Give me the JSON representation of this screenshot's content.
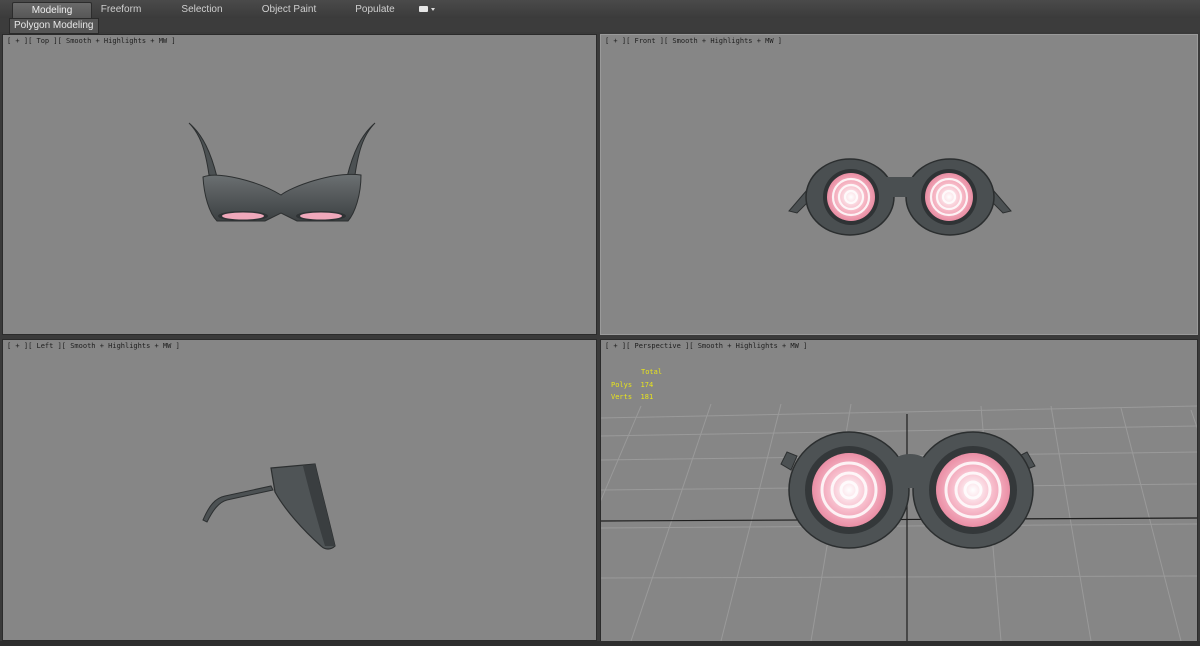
{
  "ribbon": {
    "tabs": [
      {
        "label": "Modeling",
        "active": true
      },
      {
        "label": "Freeform",
        "active": false
      },
      {
        "label": "Selection",
        "active": false
      },
      {
        "label": "Object Paint",
        "active": false
      },
      {
        "label": "Populate",
        "active": false
      }
    ],
    "panel_tab": "Polygon Modeling"
  },
  "viewports": {
    "top": {
      "label": "[ + ][ Top ][ Smooth + Highlights + MW ]"
    },
    "front": {
      "label": "[ + ][ Front ][ Smooth + Highlights + MW ]"
    },
    "left": {
      "label": "[ + ][ Left ][ Smooth + Highlights + MW ]"
    },
    "perspective": {
      "label": "[ + ][ Perspective ][ Smooth + Highlights + MW ]",
      "stats": {
        "header": "Total",
        "polys_label": "Polys",
        "polys": "174",
        "verts_label": "Verts",
        "verts": "181"
      }
    }
  },
  "colors": {
    "viewport_bg": "#868686",
    "frame_gray": "#555a5d",
    "lens_pink": "#f4a6b8",
    "stats_yellow": "#e8e41c"
  }
}
